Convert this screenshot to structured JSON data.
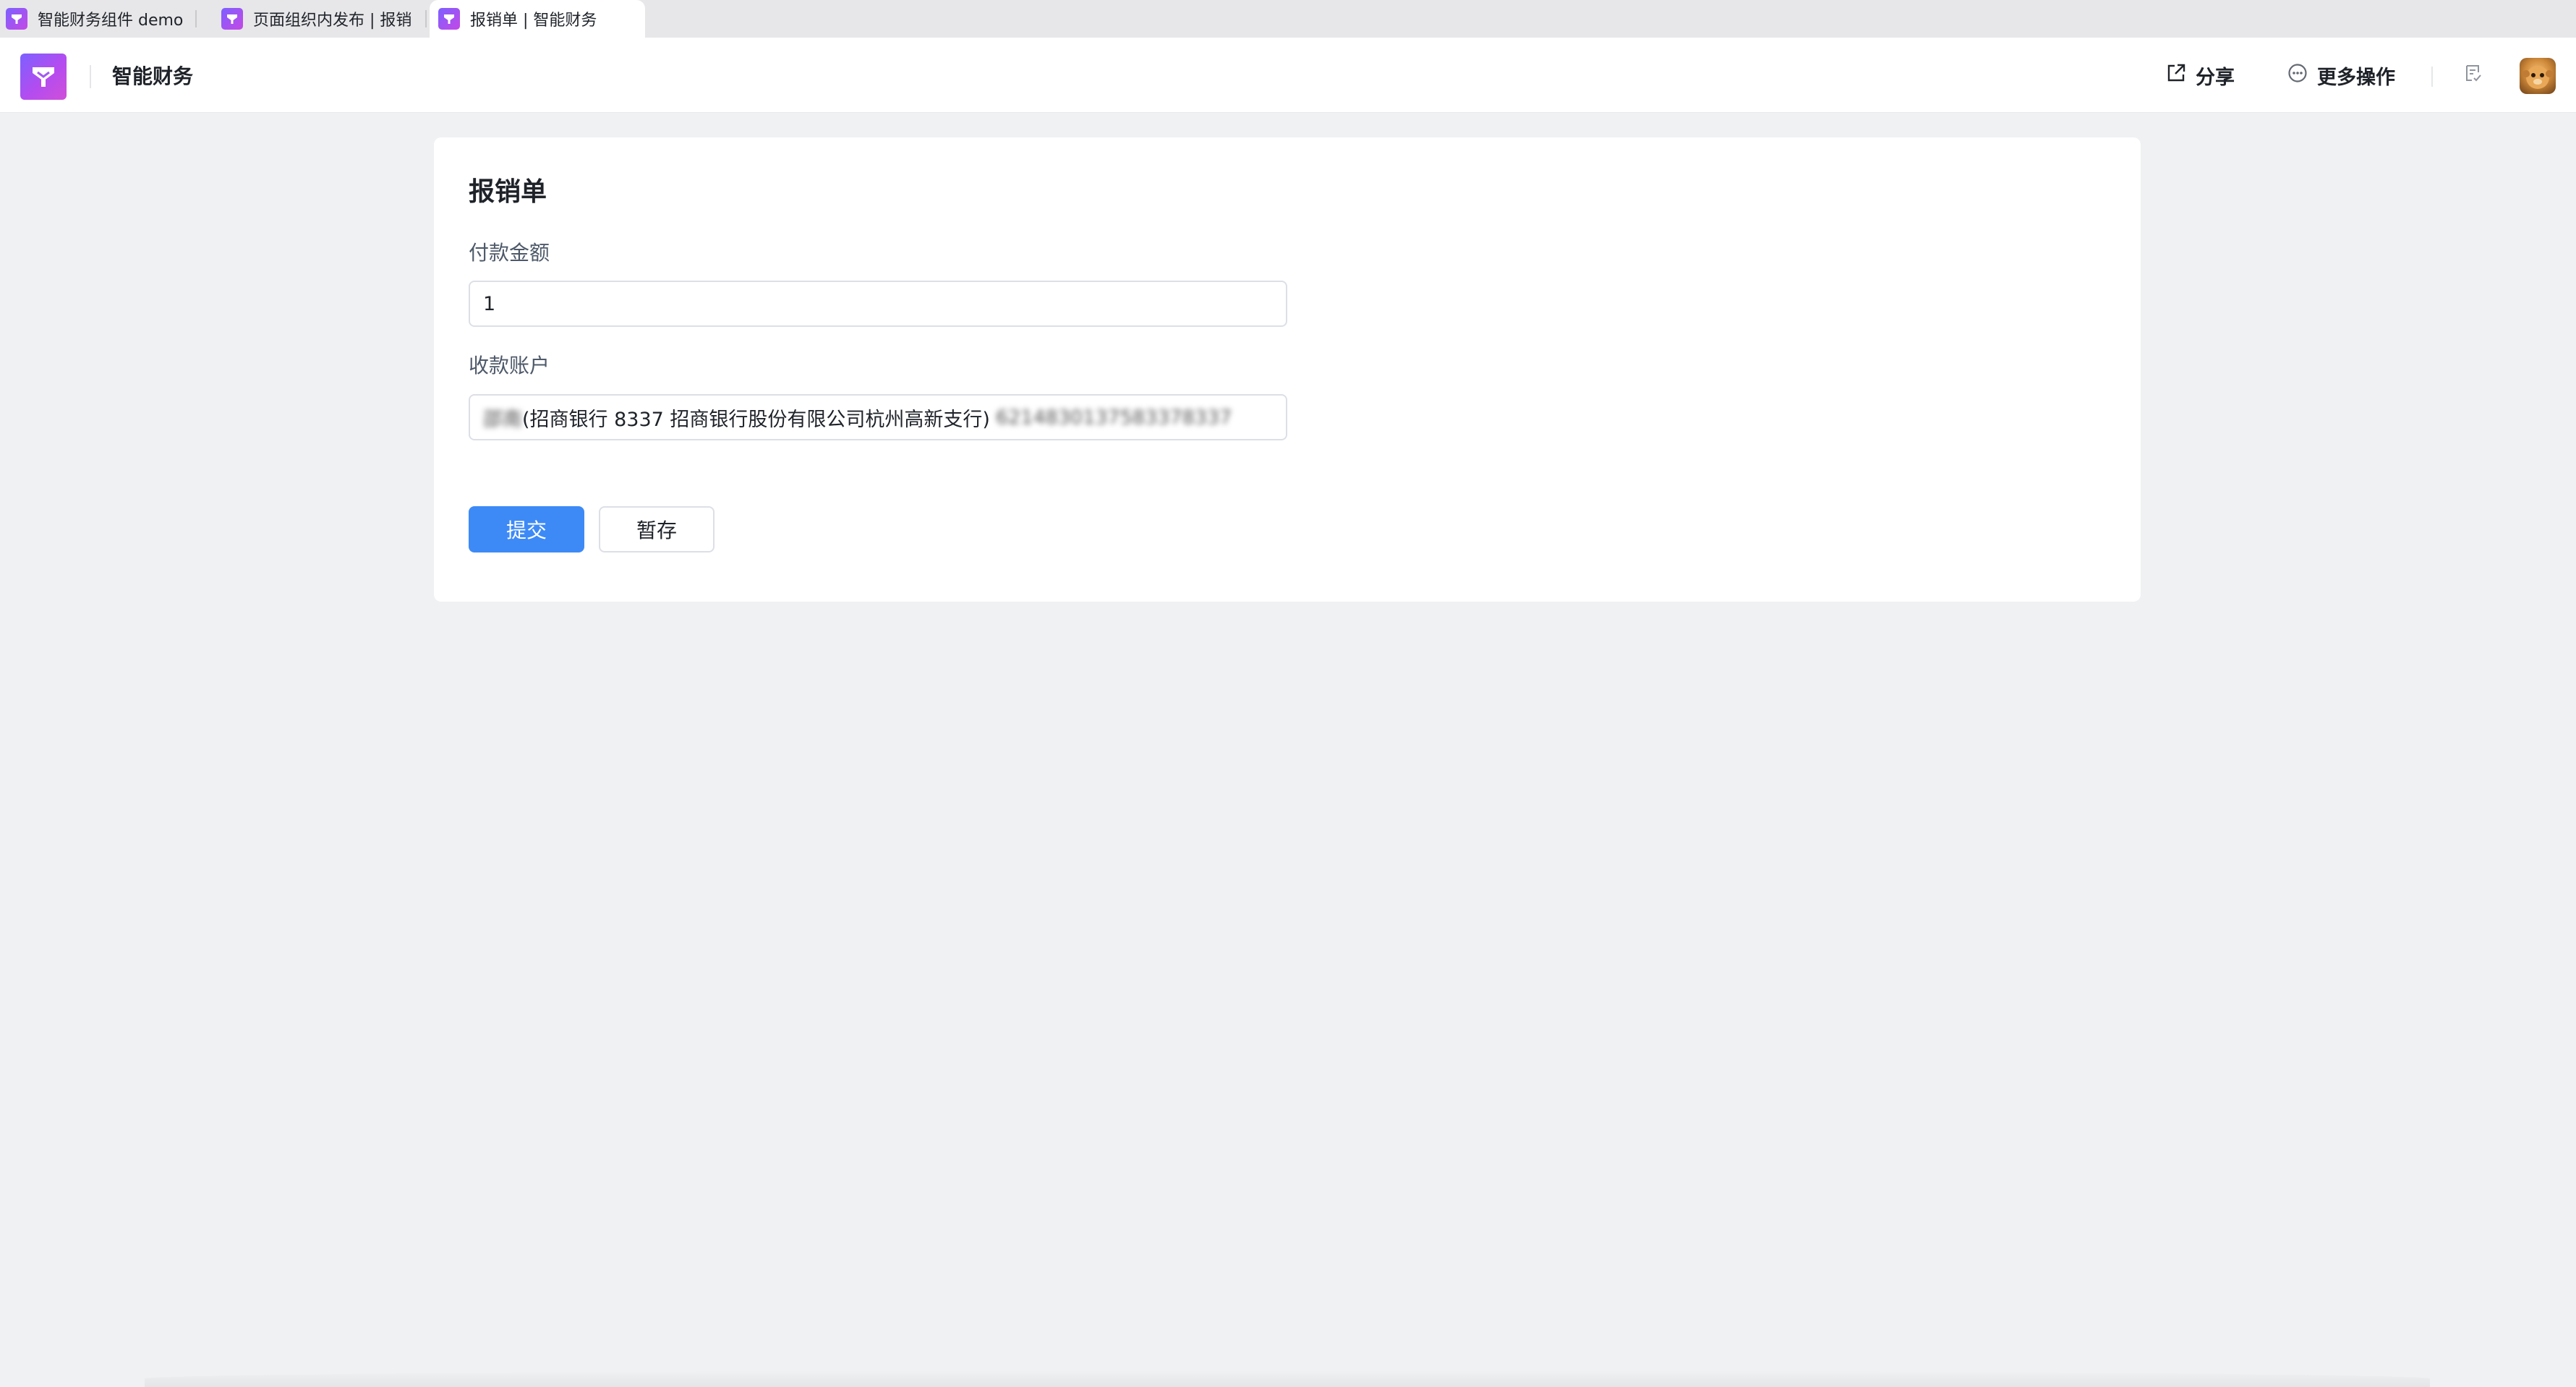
{
  "browser": {
    "tabs": [
      {
        "title": "智能财务组件 demo",
        "active": false
      },
      {
        "title": "页面组织内发布 | 报销",
        "active": false
      },
      {
        "title": "报销单 | 智能财务",
        "active": true
      }
    ]
  },
  "header": {
    "app_name": "智能财务",
    "share_label": "分享",
    "more_label": "更多操作"
  },
  "form": {
    "title": "报销单",
    "amount": {
      "label": "付款金额",
      "value": "1"
    },
    "account": {
      "label": "收款账户",
      "name_masked": "邵南",
      "value_visible": "(招商银行 8337 招商银行股份有限公司杭州高新支行)",
      "number_masked": "6214830137583378337"
    },
    "submit_label": "提交",
    "save_draft_label": "暂存"
  },
  "colors": {
    "primary": "#3d8af7",
    "brand_gradient_start": "#7b61ff",
    "brand_gradient_end": "#d04fd8",
    "page_background": "#f0f1f3"
  }
}
